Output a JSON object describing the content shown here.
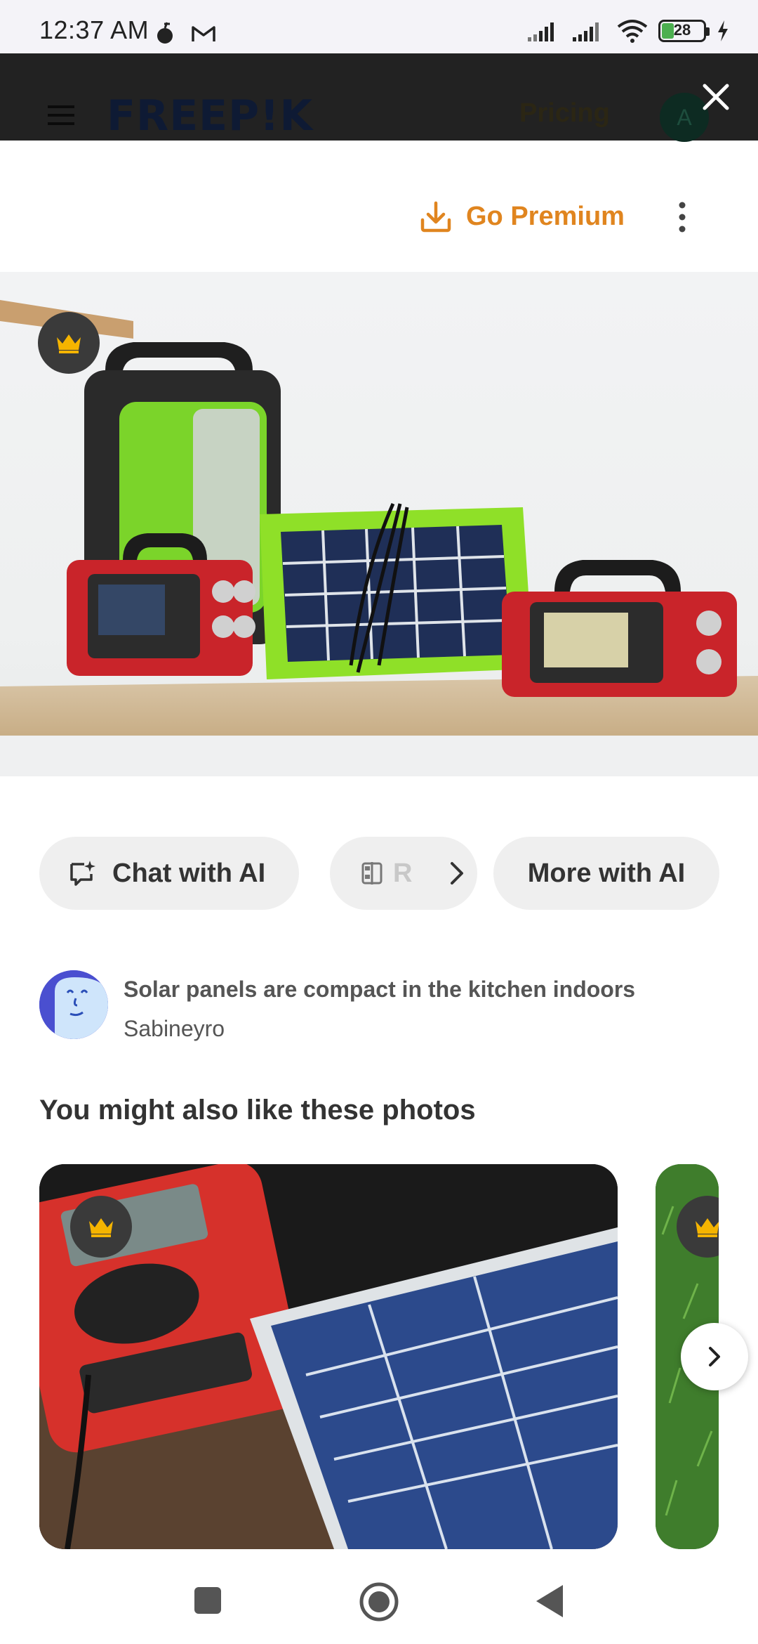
{
  "status_bar": {
    "time": "12:37 AM",
    "battery_level": "28",
    "icons": [
      "bomb-icon",
      "gmail-icon",
      "signal-icon",
      "signal-icon",
      "wifi-icon",
      "battery-icon",
      "charging-icon"
    ]
  },
  "header": {
    "logo": "FREEP!K",
    "pricing_label": "Pricing",
    "avatar_initial": "A",
    "close_icon": "close-icon",
    "menu_icon": "hamburger-icon"
  },
  "toolbar": {
    "go_premium_label": "Go Premium",
    "download_icon": "download-icon",
    "more_icon": "kebab-icon"
  },
  "hero": {
    "premium_icon": "crown-icon"
  },
  "actions": {
    "chat_label": "Chat with AI",
    "partial_label": "R",
    "more_label": "More with AI"
  },
  "author": {
    "title": "Solar panels are compact in the kitchen indoors",
    "name": "Sabineyro"
  },
  "related": {
    "heading": "You might also like these photos"
  },
  "colors": {
    "accent": "#e0851f",
    "header_dim": "#222222",
    "chip_bg": "#efefef"
  }
}
